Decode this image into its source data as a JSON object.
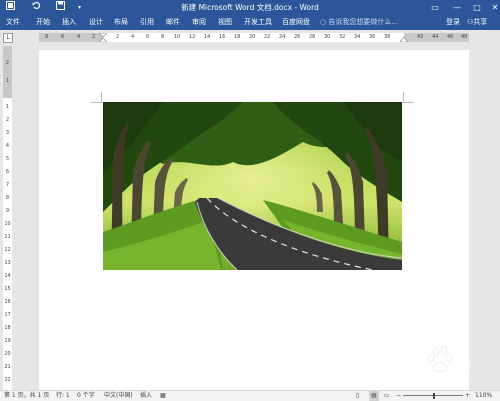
{
  "titlebar": {
    "title": "新建 Microsoft Word 文档.docx - Word",
    "save_icon": "save-icon",
    "undo_icon": "undo-icon",
    "redo_icon": "redo-icon",
    "customize_icon": "customize-icon",
    "minimize": "—",
    "restore": "□",
    "close": "✕"
  },
  "ribbon": {
    "tabs": [
      "文件",
      "开始",
      "插入",
      "设计",
      "布局",
      "引用",
      "邮件",
      "审阅",
      "视图",
      "开发工具",
      "百度网盘"
    ],
    "tellme": "告诉我您想要做什么...",
    "signin": "登录",
    "share": "共享"
  },
  "ruler": {
    "corner": "L",
    "h_left": [
      "8",
      "6",
      "4",
      "2"
    ],
    "h_mid": [
      "2",
      "4",
      "6",
      "8",
      "10",
      "12",
      "14",
      "16",
      "18",
      "20",
      "22",
      "24",
      "26",
      "28",
      "30",
      "32",
      "34",
      "36",
      "38"
    ],
    "h_right": [
      "42",
      "44",
      "46",
      "48"
    ],
    "v_numbers": [
      "2",
      "1",
      "1",
      "2",
      "3",
      "4",
      "5",
      "6",
      "7",
      "8",
      "9",
      "10",
      "11",
      "12",
      "13",
      "14",
      "15",
      "16",
      "17",
      "18",
      "19",
      "20",
      "21",
      "22",
      "23"
    ]
  },
  "statusbar": {
    "page": "第 1 页，共 1 页",
    "line": "行: 1",
    "words": "0 个字",
    "language": "中文(中国)",
    "mode": "插入",
    "zoom_minus": "−",
    "zoom_plus": "+",
    "zoom": "110%"
  },
  "watermark": {
    "text1": "Bai",
    "text2": "经验",
    "sub": "jingyan.baidu.com"
  },
  "colors": {
    "accent": "#2b579a",
    "road": "#3a3a3a",
    "foliage": "#3f7a1d"
  }
}
